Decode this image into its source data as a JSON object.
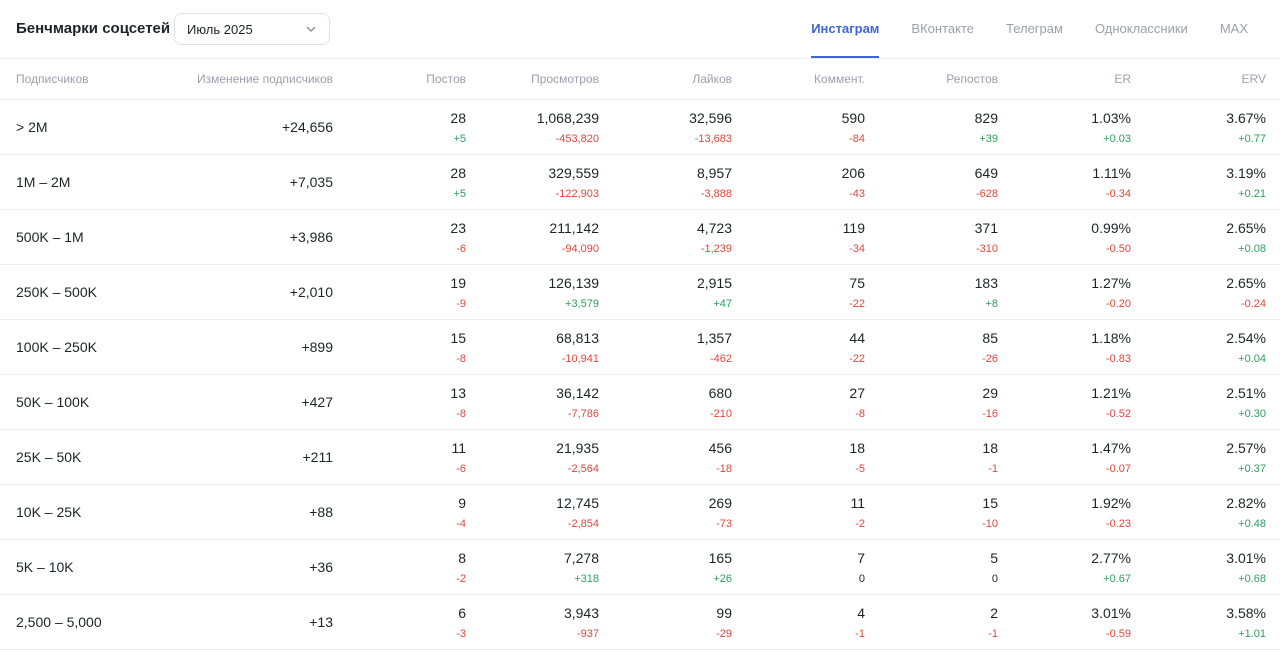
{
  "header": {
    "title": "Бенчмарки соцсетей",
    "month_value": "Июль 2025",
    "tabs": [
      "Инстаграм",
      "ВКонтакте",
      "Телеграм",
      "Одноклассники",
      "MAX"
    ],
    "active_tab": 0
  },
  "table": {
    "columns": [
      "Подписчиков",
      "Изменение подписчиков",
      "Постов",
      "Просмотров",
      "Лайков",
      "Коммент.",
      "Репостов",
      "ER",
      "ERV"
    ],
    "rows": [
      {
        "group": "> 2M",
        "change": "+24,656",
        "cells": [
          [
            "28",
            "+5"
          ],
          [
            "1,068,239",
            "-453,820"
          ],
          [
            "32,596",
            "-13,683"
          ],
          [
            "590",
            "-84"
          ],
          [
            "829",
            "+39"
          ],
          [
            "1.03%",
            "+0.03"
          ],
          [
            "3.67%",
            "+0.77"
          ]
        ]
      },
      {
        "group": "1M – 2M",
        "change": "+7,035",
        "cells": [
          [
            "28",
            "+5"
          ],
          [
            "329,559",
            "-122,903"
          ],
          [
            "8,957",
            "-3,888"
          ],
          [
            "206",
            "-43"
          ],
          [
            "649",
            "-628"
          ],
          [
            "1.11%",
            "-0.34"
          ],
          [
            "3.19%",
            "+0.21"
          ]
        ]
      },
      {
        "group": "500K – 1M",
        "change": "+3,986",
        "cells": [
          [
            "23",
            "-6"
          ],
          [
            "211,142",
            "-94,090"
          ],
          [
            "4,723",
            "-1,239"
          ],
          [
            "119",
            "-34"
          ],
          [
            "371",
            "-310"
          ],
          [
            "0.99%",
            "-0.50"
          ],
          [
            "2.65%",
            "+0.08"
          ]
        ]
      },
      {
        "group": "250K – 500K",
        "change": "+2,010",
        "cells": [
          [
            "19",
            "-9"
          ],
          [
            "126,139",
            "+3,579"
          ],
          [
            "2,915",
            "+47"
          ],
          [
            "75",
            "-22"
          ],
          [
            "183",
            "+8"
          ],
          [
            "1.27%",
            "-0.20"
          ],
          [
            "2.65%",
            "-0.24"
          ]
        ]
      },
      {
        "group": "100K – 250K",
        "change": "+899",
        "cells": [
          [
            "15",
            "-8"
          ],
          [
            "68,813",
            "-10,941"
          ],
          [
            "1,357",
            "-462"
          ],
          [
            "44",
            "-22"
          ],
          [
            "85",
            "-26"
          ],
          [
            "1.18%",
            "-0.83"
          ],
          [
            "2.54%",
            "+0.04"
          ]
        ]
      },
      {
        "group": "50K – 100K",
        "change": "+427",
        "cells": [
          [
            "13",
            "-8"
          ],
          [
            "36,142",
            "-7,786"
          ],
          [
            "680",
            "-210"
          ],
          [
            "27",
            "-8"
          ],
          [
            "29",
            "-16"
          ],
          [
            "1.21%",
            "-0.52"
          ],
          [
            "2.51%",
            "+0.30"
          ]
        ]
      },
      {
        "group": "25K – 50K",
        "change": "+211",
        "cells": [
          [
            "11",
            "-6"
          ],
          [
            "21,935",
            "-2,564"
          ],
          [
            "456",
            "-18"
          ],
          [
            "18",
            "-5"
          ],
          [
            "18",
            "-1"
          ],
          [
            "1.47%",
            "-0.07"
          ],
          [
            "2.57%",
            "+0.37"
          ]
        ]
      },
      {
        "group": "10K – 25K",
        "change": "+88",
        "cells": [
          [
            "9",
            "-4"
          ],
          [
            "12,745",
            "-2,854"
          ],
          [
            "269",
            "-73"
          ],
          [
            "11",
            "-2"
          ],
          [
            "15",
            "-10"
          ],
          [
            "1.92%",
            "-0.23"
          ],
          [
            "2.82%",
            "+0.48"
          ]
        ]
      },
      {
        "group": "5K – 10K",
        "change": "+36",
        "cells": [
          [
            "8",
            "-2"
          ],
          [
            "7,278",
            "+318"
          ],
          [
            "165",
            "+26"
          ],
          [
            "7",
            "0"
          ],
          [
            "5",
            "0"
          ],
          [
            "2.77%",
            "+0.67"
          ],
          [
            "3.01%",
            "+0.68"
          ]
        ]
      },
      {
        "group": "2,500 – 5,000",
        "change": "+13",
        "cells": [
          [
            "6",
            "-3"
          ],
          [
            "3,943",
            "-937"
          ],
          [
            "99",
            "-29"
          ],
          [
            "4",
            "-1"
          ],
          [
            "2",
            "-1"
          ],
          [
            "3.01%",
            "-0.59"
          ],
          [
            "3.58%",
            "+1.01"
          ]
        ]
      }
    ]
  },
  "colors": {
    "accent": "#3f64d9",
    "positive": "#2f9e5c",
    "negative": "#e0463b",
    "muted_text": "#9aa1ab"
  },
  "icons": {
    "month_select": "chevron-down-icon"
  }
}
